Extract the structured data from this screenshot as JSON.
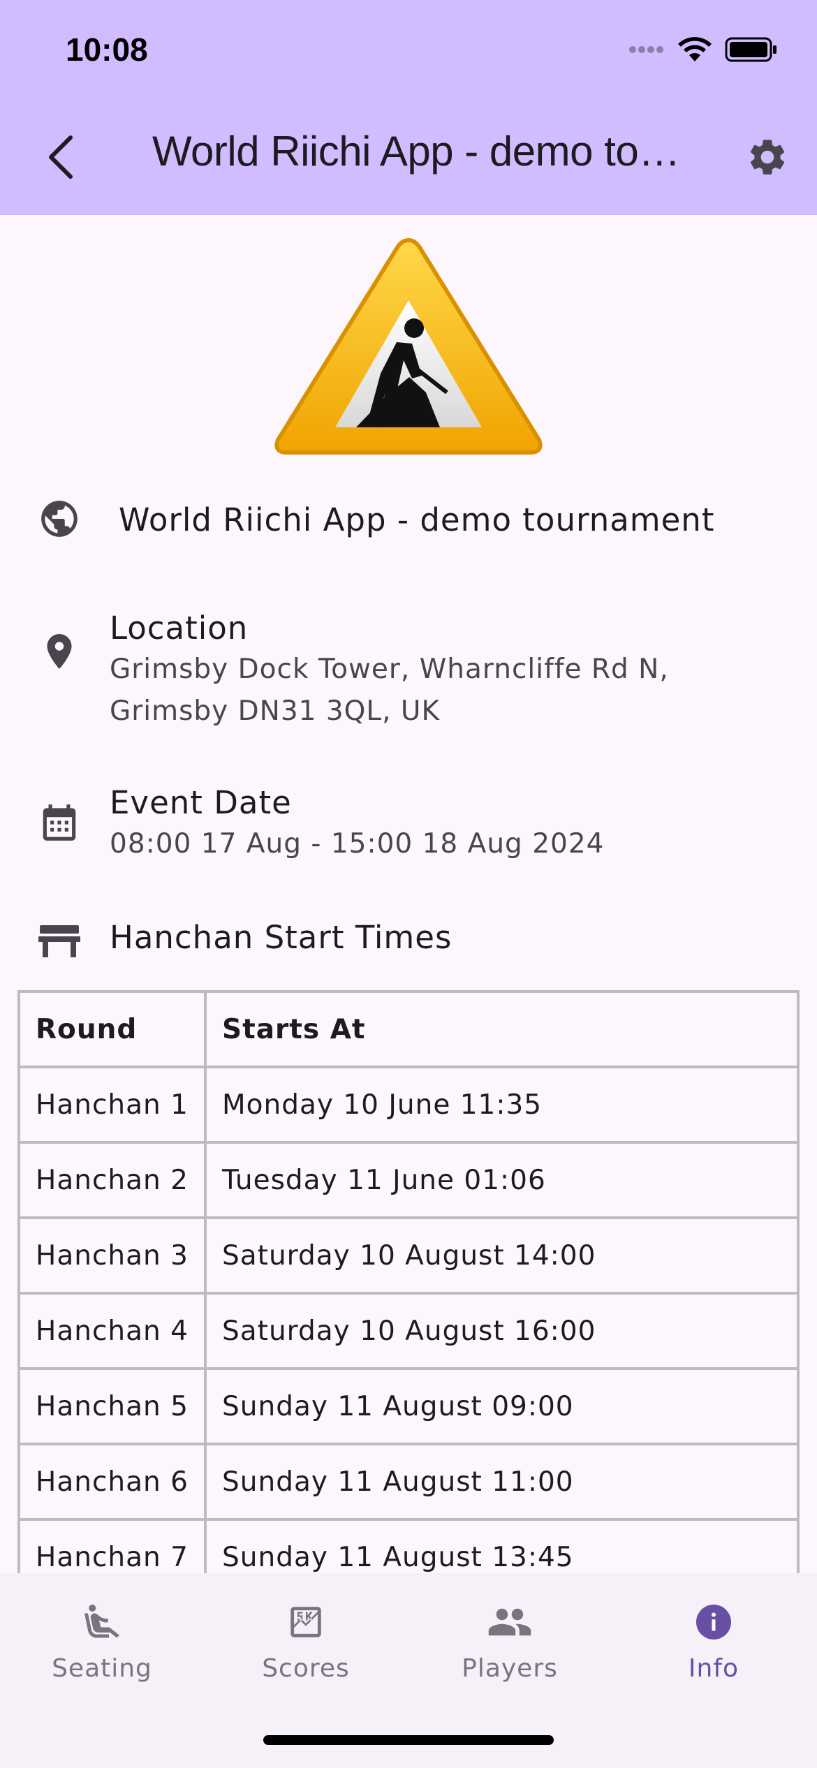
{
  "status": {
    "time": "10:08"
  },
  "header": {
    "title": "World Riichi App - demo tournament",
    "back_icon": "chevron-left-icon",
    "settings_icon": "gear-icon"
  },
  "tournament": {
    "name": "World Riichi App - demo tournament"
  },
  "location": {
    "title": "Location",
    "line1": "Grimsby Dock Tower, Wharncliffe Rd N,",
    "line2": "Grimsby DN31 3QL, UK"
  },
  "event_date": {
    "title": "Event Date",
    "value": "08:00 17 Aug - 15:00 18 Aug 2024"
  },
  "hanchan": {
    "title": "Hanchan Start Times",
    "columns": [
      "Round",
      "Starts At"
    ],
    "rows": [
      [
        "Hanchan 1",
        "Monday 10 June 11:35"
      ],
      [
        "Hanchan 2",
        "Tuesday 11 June 01:06"
      ],
      [
        "Hanchan 3",
        "Saturday 10 August 14:00"
      ],
      [
        "Hanchan 4",
        "Saturday 10 August 16:00"
      ],
      [
        "Hanchan 5",
        "Sunday 11 August 09:00"
      ],
      [
        "Hanchan 6",
        "Sunday 11 August 11:00"
      ],
      [
        "Hanchan 7",
        "Sunday 11 August 13:45"
      ]
    ]
  },
  "nav": {
    "items": [
      {
        "label": "Seating",
        "icon": "seat-icon"
      },
      {
        "label": "Scores",
        "icon": "scores-icon"
      },
      {
        "label": "Players",
        "icon": "people-icon"
      },
      {
        "label": "Info",
        "icon": "info-icon"
      }
    ],
    "active": "Info"
  },
  "colors": {
    "app_bar": "#d0bcff",
    "accent": "#6750a4",
    "background": "#fdf7fd"
  }
}
